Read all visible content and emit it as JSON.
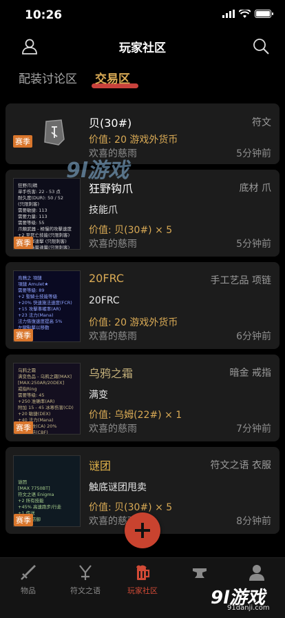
{
  "status": {
    "time": "10:26"
  },
  "nav": {
    "title": "玩家社区",
    "user_icon": "user-icon",
    "search_icon": "search-icon"
  },
  "tabs": [
    {
      "label": "配装讨论区",
      "active": false
    },
    {
      "label": "交易区",
      "active": true
    }
  ],
  "season_label": "赛季",
  "items": [
    {
      "name": "贝(30#)",
      "category": "符文",
      "desc": "",
      "price": "价值: 20 游戏外货币",
      "seller": "欢喜的慈雨",
      "time": "5分钟前",
      "thumb_lines": []
    },
    {
      "name": "狂野钩爪",
      "category": "底材 爪",
      "desc": "技能爪",
      "price": "价值: 贝(30#) × 5",
      "seller": "欢喜的慈雨",
      "time": "5分钟前",
      "thumb_lines": [
        "狂野爪|精",
        "单手伤害: 22 - 53 点",
        "耐久度(DUR): 50 / 52",
        "(只限刺客)",
        "需要敏捷: 113",
        "需要力量: 113",
        "需要等级: 55",
        "爪類武器 - 極慢的攻擊速度",
        "+2 至死亡技能(只限刺客)",
        "+1 毒擊連擊 (只限刺客)",
        "+1 至毒擊連擊(只限刺客)",
        "Ctrl + 左鍵點擊以移動"
      ]
    },
    {
      "name": "20FRC",
      "category": "手工艺品 项链",
      "desc": "20FRC",
      "price": "价值: 20 游戏外货币",
      "seller": "欢喜的慈雨",
      "time": "6分钟前",
      "thumb_lines": [
        "烏鴉之 項鏈",
        "項鏈 Amulet★",
        "需要等級: 89",
        "+2 聖騎士技能等級",
        "+20% 快速施法速度(FCR)",
        "+15 攻擊準確率(AR)",
        "+23 法力(Mana)",
        "法力恢復速度提高 5%",
        "左鍵點擊以移動"
      ]
    },
    {
      "name": "乌鸦之霜",
      "category": "暗金 戒指",
      "desc": "满变",
      "price": "价值: 乌姆(22#) × 1",
      "seller": "欢喜的慈雨",
      "time": "7分钟前",
      "thumb_lines": [
        "乌鸦之霜",
        "满变色品 - 乌鸦之霜[MAX]",
        "[MAX:250AR/20DEX]",
        "戒指Ring",
        "需要等级: 45",
        "+250 准确率(AR)",
        "附加 15 - 45 冰寒伤害(CD)",
        "+20 敏捷(DEX)",
        "+40 法力(Mana)",
        "冰寒吸收(CA) 20%",
        "無法凍結(CBF)",
        "+ 左鍵點擊以移動"
      ]
    },
    {
      "name": "谜团",
      "category": "符文之语 衣服",
      "desc": "触底谜团甩卖",
      "price": "价值: 贝(30#) × 5",
      "seller": "欢喜的慈雨",
      "time": "8分钟前",
      "thumb_lines": [
        "谜团",
        "[MAX 7750BT]",
        "符文之语 Enigma",
        "+2 所有技能",
        "+45% 高速跑步/行走",
        "+1 传送",
        "+775 防御"
      ]
    }
  ],
  "bottom_tabs": [
    {
      "label": "物品",
      "icon": "sword-icon",
      "active": false
    },
    {
      "label": "符文之语",
      "icon": "rune-icon",
      "active": false
    },
    {
      "label": "玩家社区",
      "icon": "beer-mug-icon",
      "active": true
    },
    {
      "label": "",
      "icon": "anvil-icon",
      "active": false
    },
    {
      "label": "",
      "icon": "profile-icon",
      "active": false
    }
  ],
  "watermark": {
    "logo": "9l游戏",
    "url": "91danji.com",
    "center_logo": "9l游戏"
  },
  "colors": {
    "accent_gold": "#d9aa55",
    "accent_red": "#c9432f",
    "season_orange": "#d9762c",
    "card_bg": "#1c1c1c"
  }
}
